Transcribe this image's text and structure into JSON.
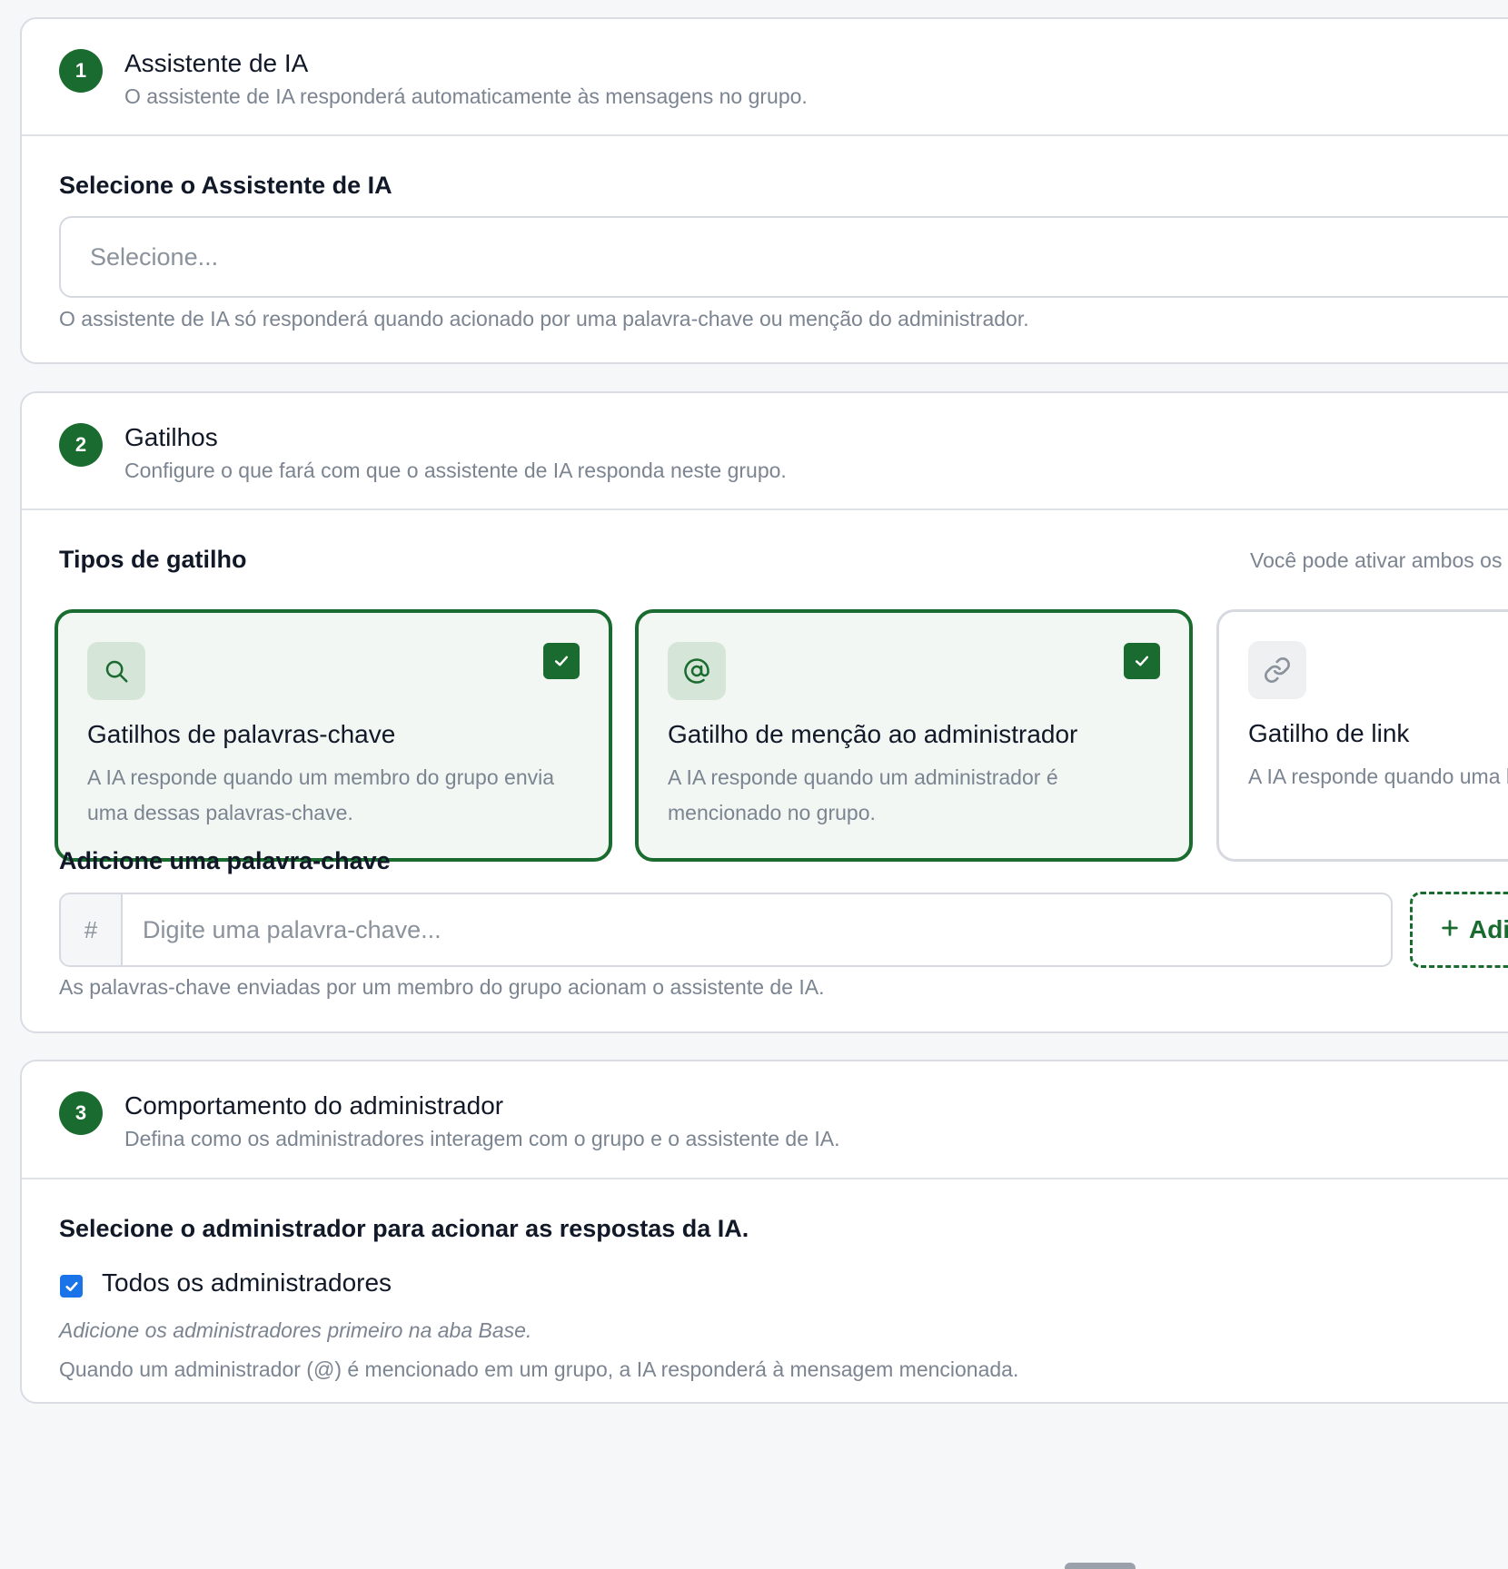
{
  "colors": {
    "accent": "#1a6b2f",
    "checkbox": "#1a73e8",
    "muted": "#7b8491"
  },
  "section1": {
    "step": "1",
    "title": "Assistente de IA",
    "description": "O assistente de IA responderá automaticamente às mensagens no grupo.",
    "select_label": "Selecione o Assistente de IA",
    "select_placeholder": "Selecione...",
    "hint": "O assistente de IA só responderá quando acionado por uma palavra-chave ou menção do administrador."
  },
  "section2": {
    "step": "2",
    "title": "Gatilhos",
    "description": "Configure o que fará com que o assistente de IA responda neste grupo.",
    "types_label": "Tipos de gatilho",
    "types_note": "Você pode ativar ambos os",
    "triggers": [
      {
        "icon": "search-icon",
        "title": "Gatilhos de palavras-chave",
        "description": "A IA responde quando um membro do grupo envia uma dessas palavras-chave.",
        "selected": true
      },
      {
        "icon": "at-sign-icon",
        "title": "Gatilho de menção ao administrador",
        "description": "A IA responde quando um administrador é mencionado no grupo.",
        "selected": true
      },
      {
        "icon": "link-icon",
        "title": "Gatilho de link",
        "description": "A IA responde quando uma link de URL.",
        "selected": false
      }
    ],
    "keyword_label": "Adicione uma palavra-chave",
    "keyword_prefix": "#",
    "keyword_placeholder": "Digite uma palavra-chave...",
    "add_button": "Adi",
    "keyword_hint": "As palavras-chave enviadas por um membro do grupo acionam o assistente de IA."
  },
  "section3": {
    "step": "3",
    "title": "Comportamento do administrador",
    "description": "Defina como os administradores interagem com o grupo e o assistente de IA.",
    "select_label": "Selecione o administrador para acionar as respostas da IA.",
    "all_admins_label": "Todos os administradores",
    "all_admins_checked": true,
    "italic_note": "Adicione os administradores primeiro na aba Base.",
    "hint": "Quando um administrador (@) é mencionado em um grupo, a IA responderá à mensagem mencionada."
  }
}
